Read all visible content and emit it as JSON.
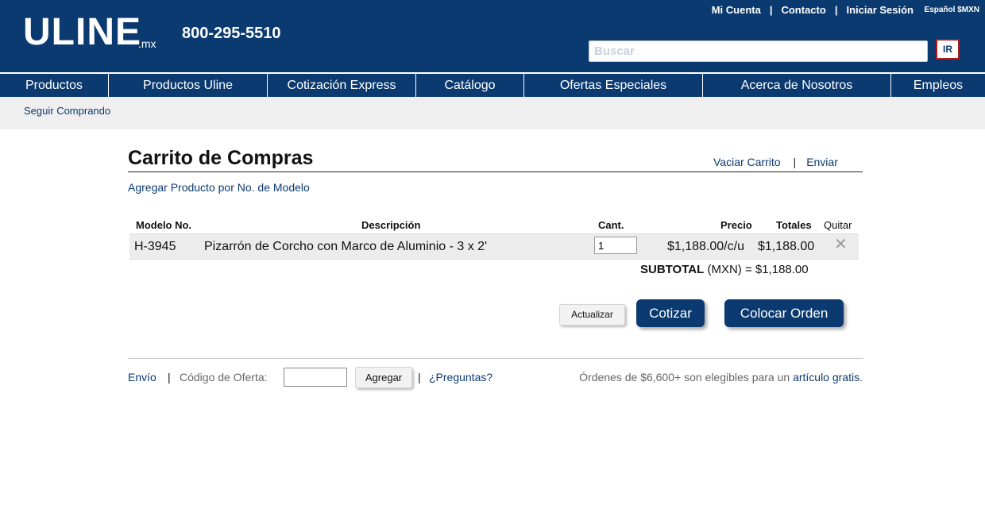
{
  "header": {
    "logo": "ULINE",
    "logo_suffix": ".mx",
    "phone": "800-295-5510",
    "links": [
      "Mi Cuenta",
      "Contacto",
      "Iniciar Sesión"
    ],
    "link_separator": "|",
    "locale": "Español $MXN",
    "search_placeholder": "Buscar",
    "go_label": "IR"
  },
  "nav": {
    "items": [
      "Productos",
      "Productos Uline",
      "Cotización Express",
      "Catálogo",
      "Ofertas Especiales",
      "Acerca de Nosotros",
      "Empleos"
    ]
  },
  "breadcrumb": {
    "continue_shopping": "Seguir Comprando"
  },
  "cart": {
    "title": "Carrito de Compras",
    "empty_cart": "Vaciar Carrito",
    "send": "Enviar",
    "separator": "|",
    "add_by_model": "Agregar Producto por No. de Modelo",
    "columns": {
      "model": "Modelo No.",
      "description": "Descripción",
      "qty": "Cant.",
      "price": "Precio",
      "totals": "Totales",
      "remove": "Quitar"
    },
    "items": [
      {
        "model": "H-3945",
        "description": "Pizarrón de Corcho con Marco de Aluminio - 3 x 2'",
        "qty": "1",
        "price": "$1,188.00/c/u",
        "total": "$1,188.00",
        "remove_symbol": "✕"
      }
    ],
    "subtotal_label": "SUBTOTAL",
    "subtotal_currency": "(MXN) =",
    "subtotal_value": "$1,188.00",
    "update_label": "Actualizar",
    "quote_label": "Cotizar",
    "order_label": "Colocar Orden"
  },
  "footer": {
    "shipping": "Envío",
    "separator": "|",
    "offer_code_label": "Código de Oferta:",
    "add_label": "Agregar",
    "questions": "¿Preguntas?",
    "promo_text": "Órdenes de $6,600+ son elegibles para un",
    "promo_link": "artículo gratis",
    "promo_end": "."
  },
  "colors": {
    "brand_navy": "#0b3a70",
    "go_border": "#b01c1c"
  }
}
